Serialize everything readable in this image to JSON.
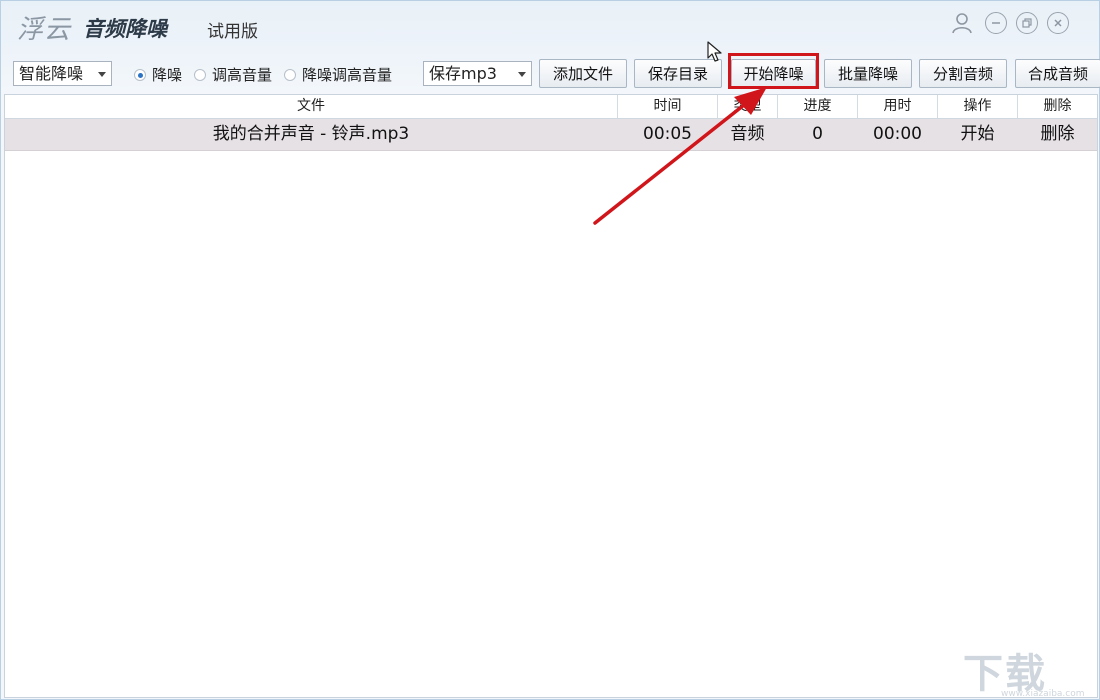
{
  "window": {
    "logo_text": "浮云",
    "app_name": "音频降噪",
    "edition": "试用版"
  },
  "toolbar": {
    "mode_select": "智能降噪",
    "radio_options": [
      {
        "label": "降噪",
        "checked": true
      },
      {
        "label": "调高音量",
        "checked": false
      },
      {
        "label": "降噪调高音量",
        "checked": false
      }
    ],
    "format_select": "保存mp3",
    "buttons": {
      "add_file": "添加文件",
      "save_dir": "保存目录",
      "start": "开始降噪",
      "batch": "批量降噪",
      "split": "分割音频",
      "merge": "合成音频"
    }
  },
  "table": {
    "columns": [
      "文件",
      "时间",
      "类型",
      "进度",
      "用时",
      "操作",
      "删除"
    ],
    "rows": [
      {
        "file": "我的合并声音 - 铃声.mp3",
        "time": "00:05",
        "type": "音频",
        "progress": "0",
        "used": "00:00",
        "action": "开始",
        "delete": "删除"
      }
    ]
  },
  "colors": {
    "highlight": "#d0161b",
    "annotation_arrow": "#d0161b",
    "selected_row": "#e6e1e5"
  },
  "watermark": {
    "logo": "下载吧",
    "url": "www.xiazaiba.com"
  }
}
